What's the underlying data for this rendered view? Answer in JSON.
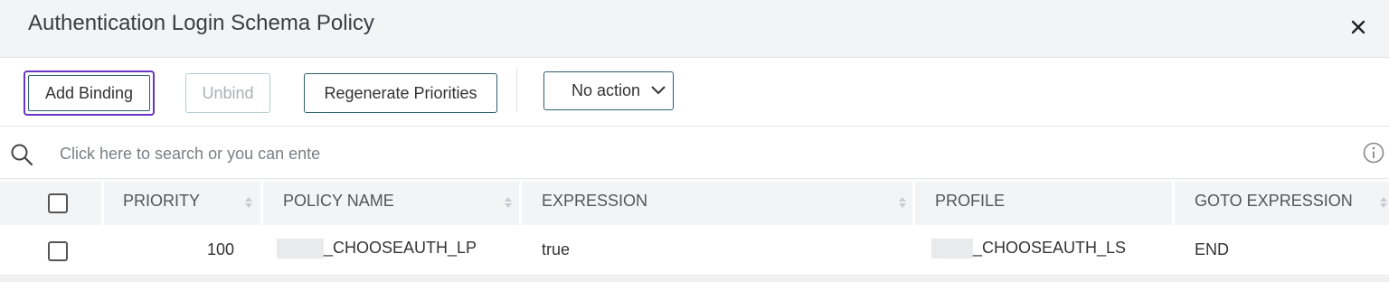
{
  "dialog": {
    "title": "Authentication Login Schema Policy",
    "close_icon": "close-icon"
  },
  "toolbar": {
    "add_binding": "Add Binding",
    "unbind": "Unbind",
    "regenerate": "Regenerate Priorities",
    "action_select": {
      "selected": "No action"
    }
  },
  "search": {
    "placeholder": "Click here to search or you can ente",
    "icon": "search-icon",
    "info_icon": "info-icon"
  },
  "table": {
    "columns": [
      "PRIORITY",
      "POLICY NAME",
      "EXPRESSION",
      "PROFILE",
      "GOTO EXPRESSION"
    ],
    "rows": [
      {
        "priority": "100",
        "policy_name": "_CHOOSEAUTH_LP",
        "expression": "true",
        "profile": "_CHOOSEAUTH_LS",
        "goto_expression": "END"
      }
    ]
  },
  "colors": {
    "focus_outline": "#6b34c2",
    "button_border": "#2f5f6e",
    "header_bg": "#f3f4f6"
  }
}
